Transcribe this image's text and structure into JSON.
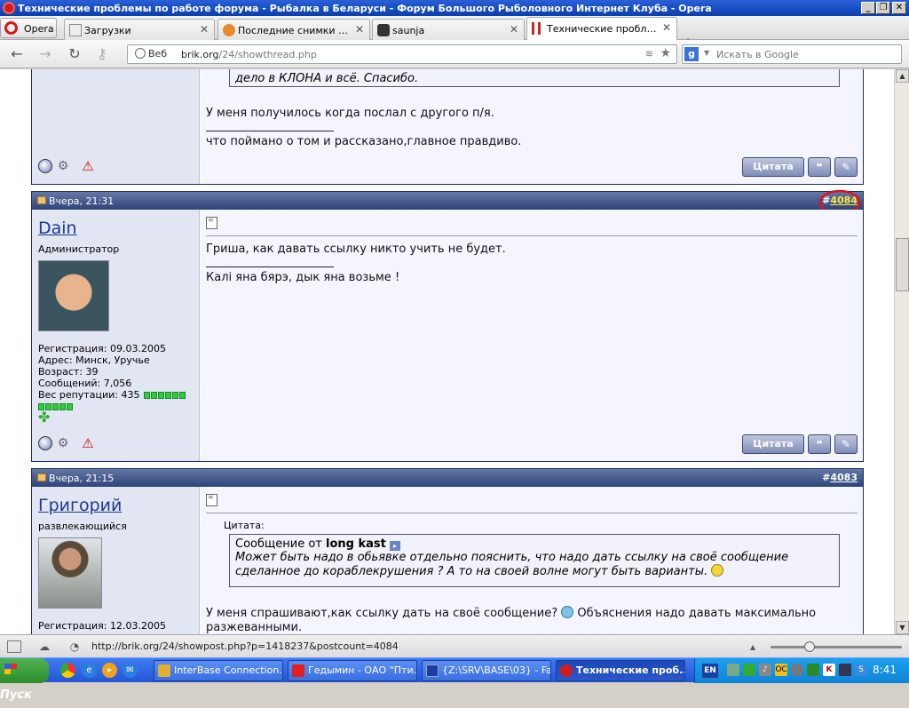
{
  "window": {
    "title": "Технические проблемы по работе форума - Рыбалка в Беларуси - Форум Большого Рыболовного Интернет Клуба - Opera"
  },
  "browser": {
    "menu_label": "Opera",
    "tabs": [
      {
        "label": "Загрузки",
        "active": false
      },
      {
        "label": "Последние снимки пого...",
        "active": false
      },
      {
        "label": "saunja",
        "active": false
      },
      {
        "label": "Технические проблемы...",
        "active": true
      }
    ],
    "address": {
      "site_label": "Веб",
      "url_host": "brik.org",
      "url_path": "/24/showthread.php"
    },
    "search": {
      "engine": "g",
      "placeholder": "Искать в Google"
    }
  },
  "forum": {
    "top_post": {
      "quote_tail": "дело в КЛОНА и всё. Спасибо.",
      "text": "У меня получилось когда послал с другого п/я.",
      "signature": "что поймано о том и рассказано,главное правдиво.",
      "quote_button": "Цитата"
    },
    "posts": [
      {
        "date": "Вчера, 21:31",
        "number_prefix": "#",
        "number": "4084",
        "username": "Dain",
        "user_title": "Администратор",
        "registration": "Регистрация: 09.03.2005",
        "address": "Адрес: Минск, Уручье",
        "age": "Возраст: 39",
        "messages": "Сообщений: 7,056",
        "reputation": "Вес репутации: 435",
        "text": "Гриша, как давать ссылку никто учить не будет.",
        "signature": "Калі яна бярэ, дык яна возьме !",
        "quote_button": "Цитата"
      },
      {
        "date": "Вчера, 21:15",
        "number_prefix": "#",
        "number": "4083",
        "username": "Григорий",
        "user_title": "развлекающийся",
        "registration": "Регистрация: 12.03.2005",
        "quote_label": "Цитата:",
        "quote_from_prefix": "Сообщение от ",
        "quote_author": "long kast",
        "quote_text_1": "Может быть надо в обьявке отдельно пояснить, что надо дать ссылку на своё сообщение",
        "quote_text_2": "сделанное до кораблекрушения ? А то на своей волне могут быть варианты.",
        "text_1": "У меня спрашивают,как ссылку дать на своё сообщение?",
        "text_1b": "Объяснения надо давать максимально",
        "text_2": "разжеванными."
      }
    ]
  },
  "statusbar": {
    "link": "http://brik.org/24/showpost.php?p=1418237&postcount=4084"
  },
  "taskbar": {
    "start_label": "Пуск",
    "tasks": [
      {
        "label": "InterBase Connection..."
      },
      {
        "label": "Гедымин - ОАО \"Пти..."
      },
      {
        "label": "{Z:\\SRV\\BASE\\03} - Far"
      },
      {
        "label": "Технические проб..."
      }
    ],
    "lang": "EN",
    "clock": "8:41"
  },
  "colors": {
    "post_header": "#2e4378",
    "highlight_number": "#ffeb3b",
    "circle_mark": "#e0101a"
  }
}
